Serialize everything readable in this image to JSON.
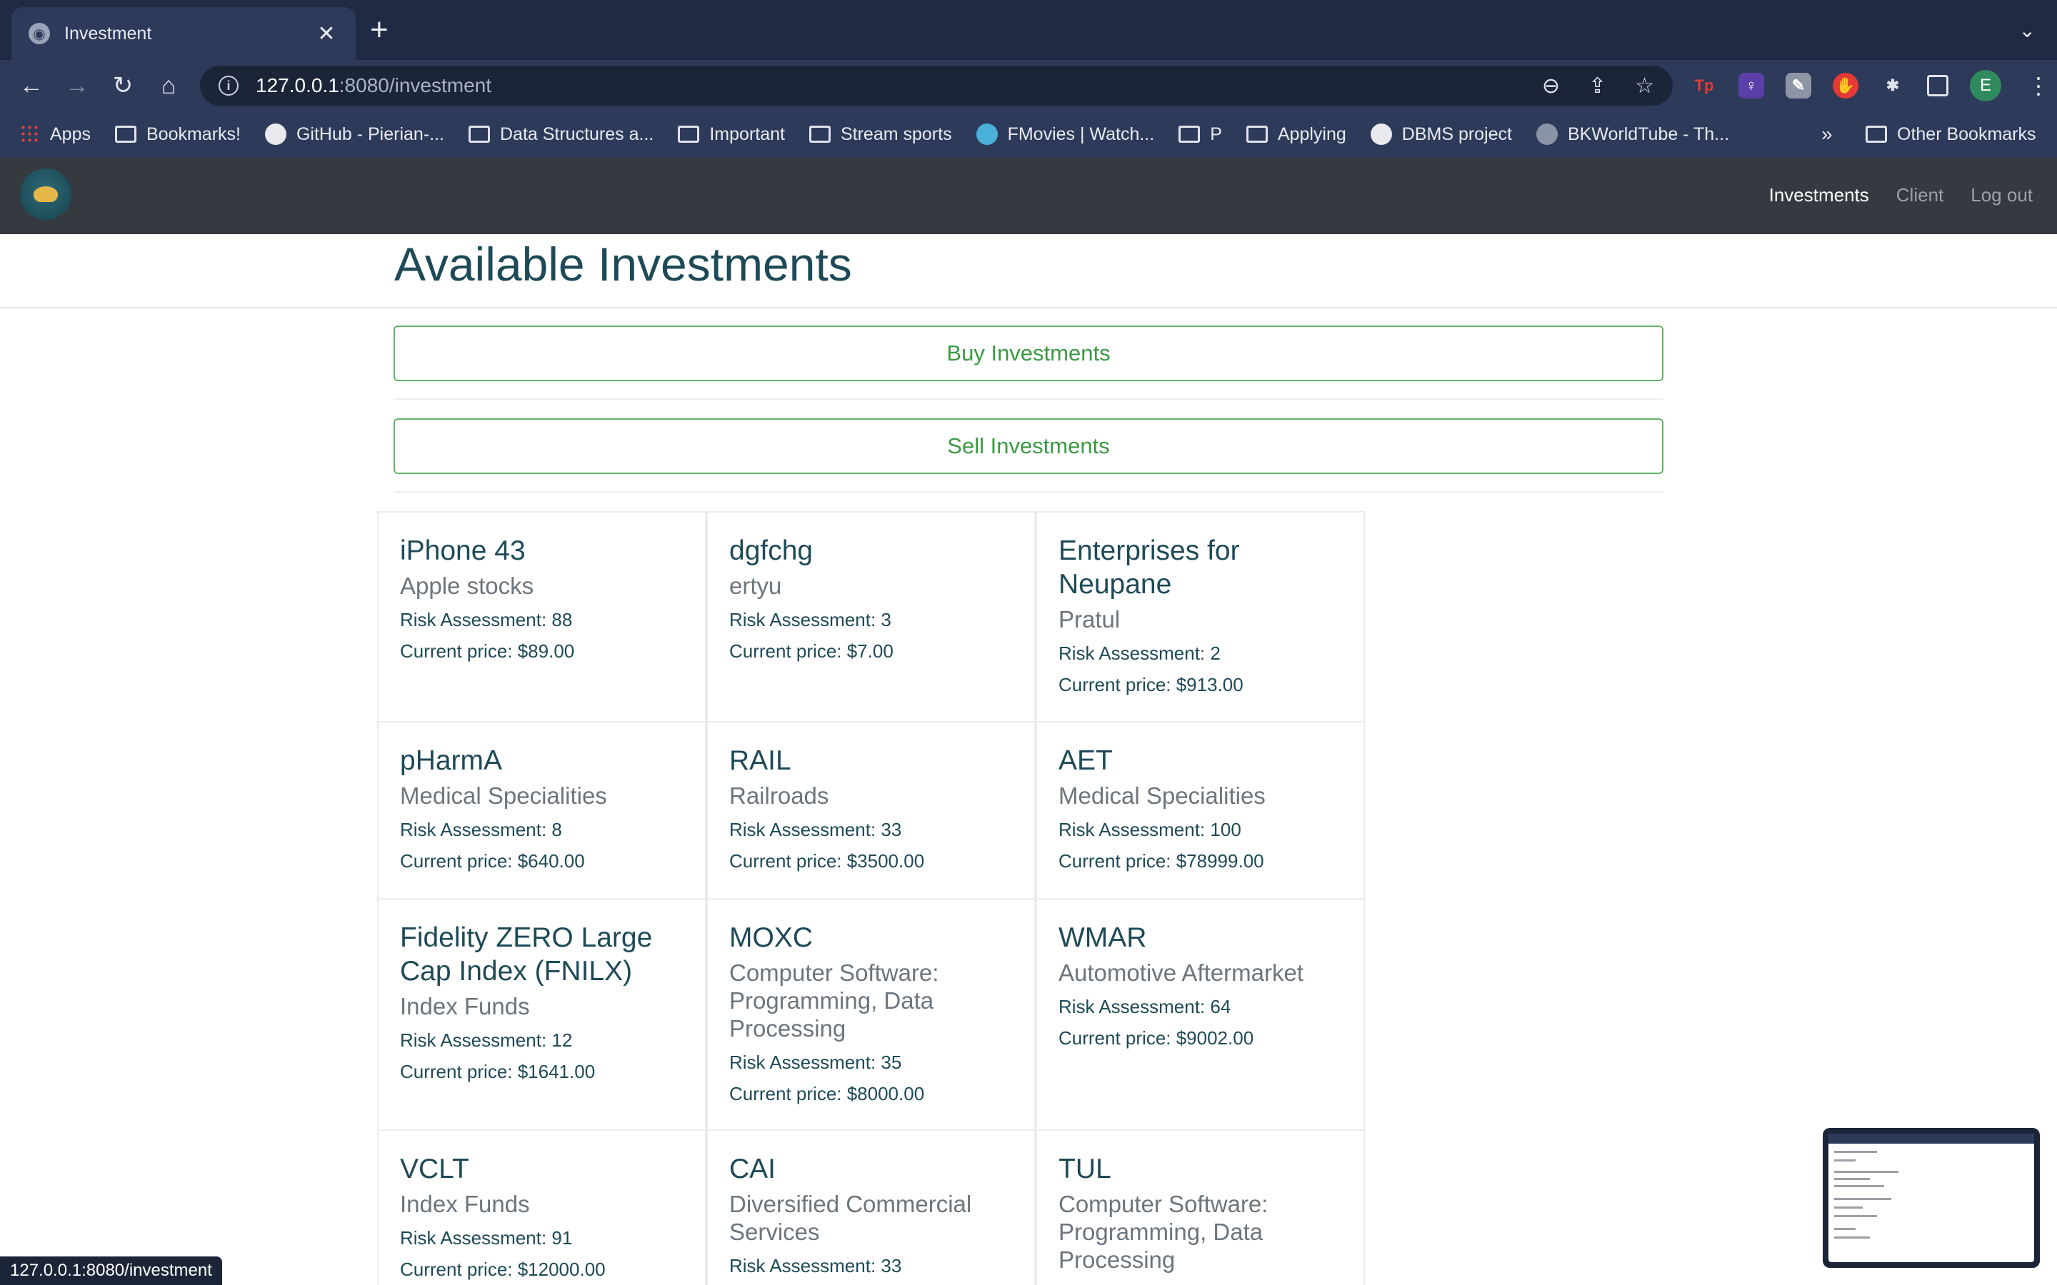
{
  "browser": {
    "tab_title": "Investment",
    "new_tab_icon": "plus-icon",
    "url_host": "127.0.0.1",
    "url_path": ":8080/investment",
    "bookmarks": [
      {
        "label": "Apps",
        "icon": "apps-icon"
      },
      {
        "label": "Bookmarks!",
        "icon": "folder-icon"
      },
      {
        "label": "GitHub - Pierian-...",
        "icon": "github-icon"
      },
      {
        "label": "Data Structures a...",
        "icon": "folder-icon"
      },
      {
        "label": "Important",
        "icon": "folder-icon"
      },
      {
        "label": "Stream sports",
        "icon": "folder-icon"
      },
      {
        "label": "FMovies | Watch...",
        "icon": "play-icon"
      },
      {
        "label": "P",
        "icon": "folder-icon"
      },
      {
        "label": "Applying",
        "icon": "folder-icon"
      },
      {
        "label": "DBMS project",
        "icon": "github-icon"
      },
      {
        "label": "BKWorldTube - Th...",
        "icon": "globe-icon"
      }
    ],
    "bookmarks_more": "»",
    "other_bookmarks": "Other Bookmarks",
    "profile_initial": "E",
    "status_url": "127.0.0.1:8080/investment"
  },
  "nav": {
    "links": [
      "Investments",
      "Client",
      "Log out"
    ]
  },
  "page": {
    "title": "Available Investments",
    "buy_label": "Buy Investments",
    "sell_label": "Sell Investments"
  },
  "investments": [
    {
      "name": "iPhone 43",
      "category": "Apple stocks",
      "risk": "Risk Assessment: 88",
      "price": "Current price: $89.00"
    },
    {
      "name": "dgfchg",
      "category": "ertyu",
      "risk": "Risk Assessment: 3",
      "price": "Current price: $7.00"
    },
    {
      "name": "Enterprises for Neupane",
      "category": "Pratul",
      "risk": "Risk Assessment: 2",
      "price": "Current price: $913.00"
    },
    {
      "name": "pHarmA",
      "category": "Medical Specialities",
      "risk": "Risk Assessment: 8",
      "price": "Current price: $640.00"
    },
    {
      "name": "RAIL",
      "category": "Railroads",
      "risk": "Risk Assessment: 33",
      "price": "Current price: $3500.00"
    },
    {
      "name": "AET",
      "category": "Medical Specialities",
      "risk": "Risk Assessment: 100",
      "price": "Current price: $78999.00"
    },
    {
      "name": "Fidelity ZERO Large Cap Index (FNILX)",
      "category": "Index Funds",
      "risk": "Risk Assessment: 12",
      "price": "Current price: $1641.00"
    },
    {
      "name": "MOXC",
      "category": "Computer Software: Programming, Data Processing",
      "risk": "Risk Assessment: 35",
      "price": "Current price: $8000.00"
    },
    {
      "name": "WMAR",
      "category": "Automotive Aftermarket",
      "risk": "Risk Assessment: 64",
      "price": "Current price: $9002.00"
    },
    {
      "name": "VCLT",
      "category": "Index Funds",
      "risk": "Risk Assessment: 91",
      "price": "Current price: $12000.00"
    },
    {
      "name": "CAI",
      "category": "Diversified Commercial Services",
      "risk": "Risk Assessment: 33",
      "price": ""
    },
    {
      "name": "TUL",
      "category": "Computer Software: Programming, Data Processing",
      "risk": "",
      "price": ""
    }
  ]
}
